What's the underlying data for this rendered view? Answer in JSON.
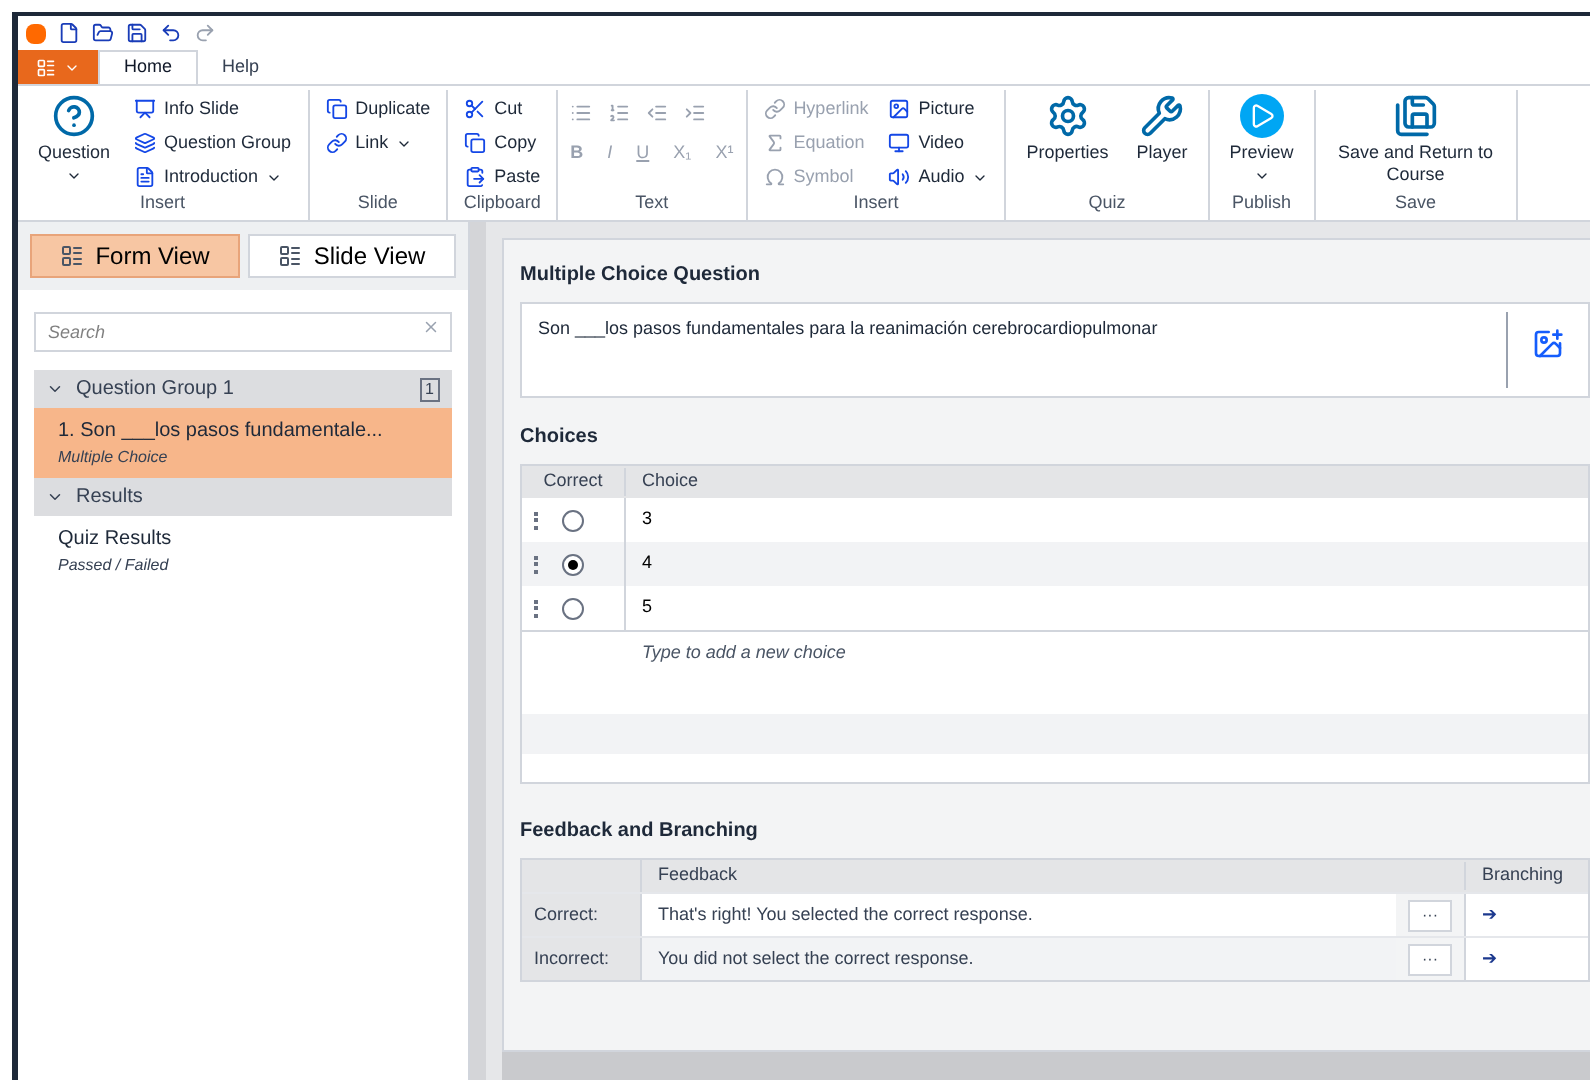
{
  "quick_access": {
    "items": [
      {
        "kind": "new"
      },
      {
        "kind": "open"
      },
      {
        "kind": "save"
      },
      {
        "kind": "undo"
      },
      {
        "kind": "redo"
      }
    ]
  },
  "ribbon_tabs": [
    {
      "kind": "file",
      "selected": false
    },
    {
      "label": "Home",
      "kind": "tab",
      "selected": true
    },
    {
      "label": "Help",
      "kind": "tab",
      "selected": false
    }
  ],
  "ribbon_groups": [
    {
      "label": "Insert",
      "large": [
        {
          "label": "Question",
          "kind": "question",
          "dropdown": true
        }
      ],
      "columns": [
        [
          {
            "label": "Info Slide",
            "kind": "slide",
            "disabled": false,
            "dropdown": false
          },
          {
            "label": "Question Group",
            "kind": "group",
            "disabled": false,
            "dropdown": false
          },
          {
            "label": "Introduction",
            "kind": "intro",
            "disabled": false,
            "dropdown": true
          }
        ]
      ]
    },
    {
      "label": "Slide",
      "columns": [
        [
          {
            "label": "Duplicate",
            "kind": "copy",
            "disabled": false,
            "dropdown": false
          },
          {
            "label": "Link",
            "kind": "link",
            "disabled": false,
            "dropdown": true
          }
        ]
      ]
    },
    {
      "label": "Clipboard",
      "columns": [
        [
          {
            "label": "Cut",
            "kind": "cut",
            "disabled": false,
            "dropdown": false
          },
          {
            "label": "Copy",
            "kind": "copy",
            "disabled": false,
            "dropdown": false
          },
          {
            "label": "Paste",
            "kind": "paste",
            "disabled": false,
            "dropdown": false
          }
        ]
      ]
    },
    {
      "label": "Text",
      "kind": "text",
      "format_buttons": [
        "B",
        "I",
        "U",
        "X₁",
        "X¹"
      ]
    },
    {
      "label": "Insert",
      "columns": [
        [
          {
            "label": "Hyperlink",
            "kind": "link",
            "disabled": true,
            "dropdown": false
          },
          {
            "label": "Equation",
            "kind": "pi",
            "disabled": true,
            "dropdown": false
          },
          {
            "label": "Symbol",
            "kind": "omega",
            "disabled": true,
            "dropdown": false
          }
        ],
        [
          {
            "label": "Picture",
            "kind": "image",
            "disabled": false,
            "dropdown": false
          },
          {
            "label": "Video",
            "kind": "video",
            "disabled": false,
            "dropdown": false
          },
          {
            "label": "Audio",
            "kind": "audio",
            "disabled": false,
            "dropdown": true
          }
        ]
      ]
    },
    {
      "label": "Quiz",
      "large": [
        {
          "label": "Properties",
          "kind": "gear",
          "dropdown": false
        },
        {
          "label": "Player",
          "kind": "player",
          "dropdown": false
        }
      ]
    },
    {
      "label": "Publish",
      "large": [
        {
          "label": "Preview",
          "kind": "play",
          "dropdown": true
        }
      ]
    },
    {
      "label": "Save",
      "large": [
        {
          "label": "Save and Return to Course",
          "kind": "save",
          "dropdown": false
        }
      ]
    }
  ],
  "view_toggle": [
    {
      "label": "Form View",
      "selected": true
    },
    {
      "label": "Slide View",
      "selected": false
    }
  ],
  "search": {
    "placeholder": "Search"
  },
  "tree": [
    {
      "label": "Question Group 1",
      "count": "1",
      "expanded": true,
      "children": [
        {
          "title": "1. Son ___los pasos fundamentale...",
          "subtitle": "Multiple Choice",
          "selected": true
        }
      ]
    },
    {
      "label": "Results",
      "expanded": true,
      "children": [
        {
          "title": "Quiz Results",
          "subtitle": "Passed / Failed",
          "selected": false
        }
      ]
    }
  ],
  "question": {
    "heading": "Multiple Choice Question",
    "text": "Son ___los pasos fundamentales para la reanimación cerebrocardiopulmonar"
  },
  "choices": {
    "heading": "Choices",
    "columns": [
      "Correct",
      "Choice"
    ],
    "rows": [
      {
        "text": "3",
        "selected": false
      },
      {
        "text": "4",
        "selected": true
      },
      {
        "text": "5",
        "selected": false
      }
    ],
    "placeholder": "Type to add a new choice"
  },
  "feedback": {
    "heading": "Feedback and Branching",
    "columns": [
      "Feedback",
      "Branching"
    ],
    "rows": [
      {
        "label": "Correct:",
        "text": "That's right! You selected the correct response.",
        "button": "···",
        "arrow": "➔"
      },
      {
        "label": "Incorrect:",
        "text": "You did not select the correct response.",
        "button": "···",
        "arrow": "➔"
      }
    ]
  }
}
